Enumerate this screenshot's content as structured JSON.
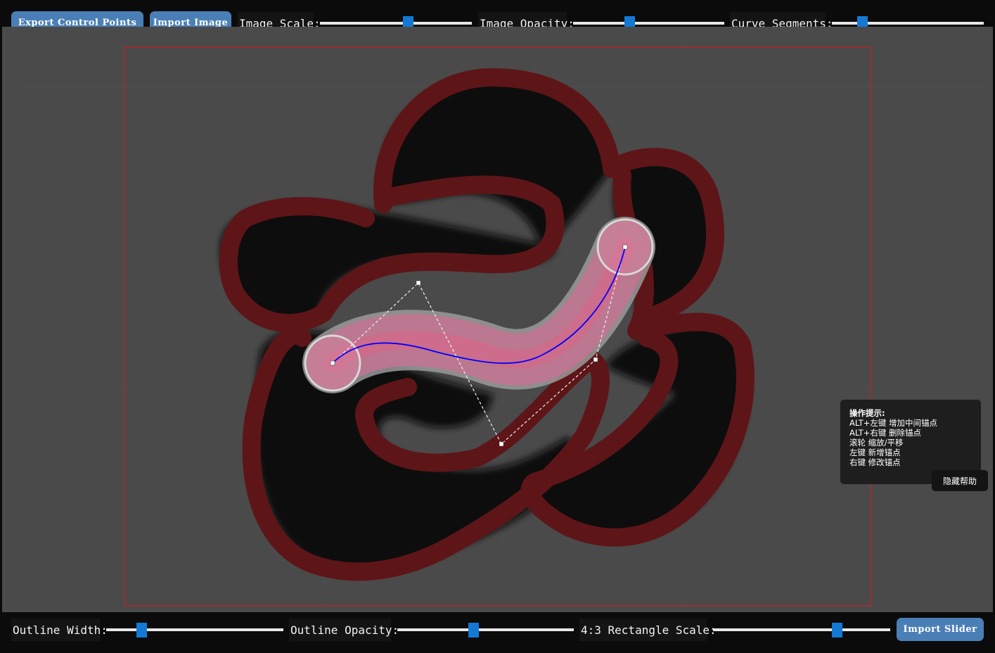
{
  "toolbar_top": {
    "export_label": "Export Control Points",
    "import_image_label": "Import Image",
    "image_scale_label": "Image Scale:",
    "image_opacity_label": "Image Opacity:",
    "curve_segments_label": "Curve Segments:",
    "image_scale_value": 0.58,
    "image_opacity_value": 0.37,
    "curve_segments_value": 0.2
  },
  "toolbar_bottom": {
    "outline_width_label": "Outline Width:",
    "outline_opacity_label": "Outline Opacity:",
    "rect_scale_label": "4:3 Rectangle Scale:",
    "import_slider_label": "Import Slider",
    "outline_width_value": 0.2,
    "outline_opacity_value": 0.43,
    "rect_scale_value": 0.7
  },
  "help": {
    "title": "操作提示:",
    "lines": [
      "ALT+左键 增加中间锚点",
      "ALT+右键 删除锚点",
      "滚轮 缩放/平移",
      "左键 新增锚点",
      "右键 修改锚点"
    ],
    "hide_label": "隐藏帮助"
  },
  "colors": {
    "button": "#4a7fb6",
    "slider_thumb": "#1479d4",
    "canvas_bg": "#4a4a4a",
    "outline": "#5e1518",
    "rect_border": "#b02828",
    "curve": "#0000ff",
    "slider_body": "#e0809a"
  }
}
